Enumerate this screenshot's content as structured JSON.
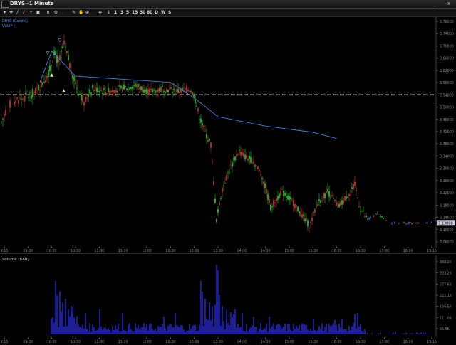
{
  "window": {
    "title": "DRYS--1 Minute",
    "minimize": "_",
    "close": "x"
  },
  "toolbar": {
    "icons": [
      "dropdown-arrow",
      "crosshair",
      "draw-line",
      "draw-line-alt",
      "fork",
      "clone",
      "magnet",
      "gear",
      "arrows-horizontal",
      "arrows-vertical"
    ],
    "timeframes": [
      "1",
      "3",
      "5",
      "15",
      "30",
      "60",
      "D",
      "W",
      "$"
    ]
  },
  "price_panel": {
    "study_label_1": "DRYS (Candle)",
    "study_label_2": "VWAP ()",
    "last_price_tag": "3.13000",
    "y_ticks": [
      "3.78000",
      "3.74000",
      "3.70000",
      "3.66000",
      "3.62000",
      "3.58000",
      "3.54000",
      "3.50000",
      "3.46000",
      "3.42000",
      "3.38000",
      "3.34000",
      "3.30000",
      "3.26000",
      "3.22000",
      "3.18000",
      "3.14000",
      "3.10000",
      "3.06000"
    ],
    "x_ticks": [
      "9:15",
      "09:30",
      "10:00",
      "10:30",
      "11:00",
      "11:30",
      "12:00",
      "12:30",
      "13:00",
      "13:30",
      "14:00",
      "14:30",
      "15:00",
      "15:30",
      "16:00",
      "16:30",
      "17:00",
      "18:00",
      "19:15"
    ]
  },
  "volume_panel": {
    "label": "Volume (BAR)",
    "y_ticks": [
      "388.2K",
      "333.2K",
      "277.6K",
      "222.1K",
      "166.5K",
      "111.0K",
      "55.5K"
    ],
    "x_ticks": [
      "9:15",
      "09:30",
      "10:00",
      "10:30",
      "11:00",
      "11:30",
      "12:00",
      "12:30",
      "13:00",
      "13:30",
      "14:00",
      "14:30",
      "15:00",
      "15:30",
      "16:00",
      "16:30",
      "17:00",
      "18:00",
      "19:15"
    ]
  },
  "colors": {
    "background": "#000000",
    "bull": "#3cc43c",
    "bear": "#c43c3c",
    "vwap": "#4a7fd8",
    "volume": "#2a2ad8",
    "reference_line": "#e8e8e8",
    "axis_text": "#8a8a8a",
    "label_text": "#5a8fe0"
  },
  "chart_data": {
    "type": "candlestick",
    "symbol": "DRYS",
    "interval": "1 Minute",
    "ylim": [
      3.06,
      3.78
    ],
    "reference_level": 3.54,
    "last_price": 3.13,
    "vwap_path": [
      {
        "t": "09:45",
        "y": 3.58
      },
      {
        "t": "10:00",
        "y": 3.68
      },
      {
        "t": "10:30",
        "y": 3.6
      },
      {
        "t": "11:30",
        "y": 3.59
      },
      {
        "t": "12:30",
        "y": 3.58
      },
      {
        "t": "13:00",
        "y": 3.53
      },
      {
        "t": "13:30",
        "y": 3.47
      },
      {
        "t": "14:30",
        "y": 3.44
      },
      {
        "t": "15:30",
        "y": 3.42
      },
      {
        "t": "16:00",
        "y": 3.4
      }
    ],
    "markers": [
      {
        "label": "▽",
        "t": "10:10",
        "y": 3.71
      },
      {
        "label": "▽",
        "t": "09:55",
        "y": 3.67
      },
      {
        "label": "▲",
        "t": "10:00",
        "y": 3.6
      },
      {
        "label": "▲",
        "t": "10:15",
        "y": 3.55
      }
    ]
  }
}
